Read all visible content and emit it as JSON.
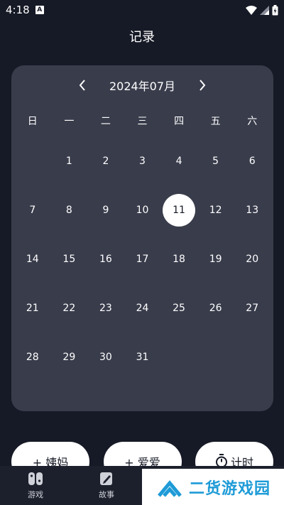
{
  "status_bar": {
    "time": "4:18",
    "notification": "A"
  },
  "header": {
    "title": "记录"
  },
  "calendar": {
    "month_label": "2024年07月",
    "weekdays": [
      "日",
      "一",
      "二",
      "三",
      "四",
      "五",
      "六"
    ],
    "days": [
      "",
      "1",
      "2",
      "3",
      "4",
      "5",
      "6",
      "7",
      "8",
      "9",
      "10",
      "11",
      "12",
      "13",
      "14",
      "15",
      "16",
      "17",
      "18",
      "19",
      "20",
      "21",
      "22",
      "23",
      "24",
      "25",
      "26",
      "27",
      "28",
      "29",
      "30",
      "31",
      "",
      "",
      ""
    ],
    "selected_day": "11"
  },
  "actions": {
    "period_label": "+ 姨妈",
    "love_label": "+ 爱爱",
    "timer_label": "计时",
    "timer_icon": "stopwatch-icon"
  },
  "bottom_nav": {
    "items": [
      {
        "label": "游戏",
        "icon": "gamepad-icon"
      },
      {
        "label": "故事",
        "icon": "story-icon"
      }
    ]
  },
  "watermark": {
    "text": "二货游戏园"
  },
  "colors": {
    "background": "#161a26",
    "card": "#393c4b",
    "accent": "#1e9bd7"
  }
}
